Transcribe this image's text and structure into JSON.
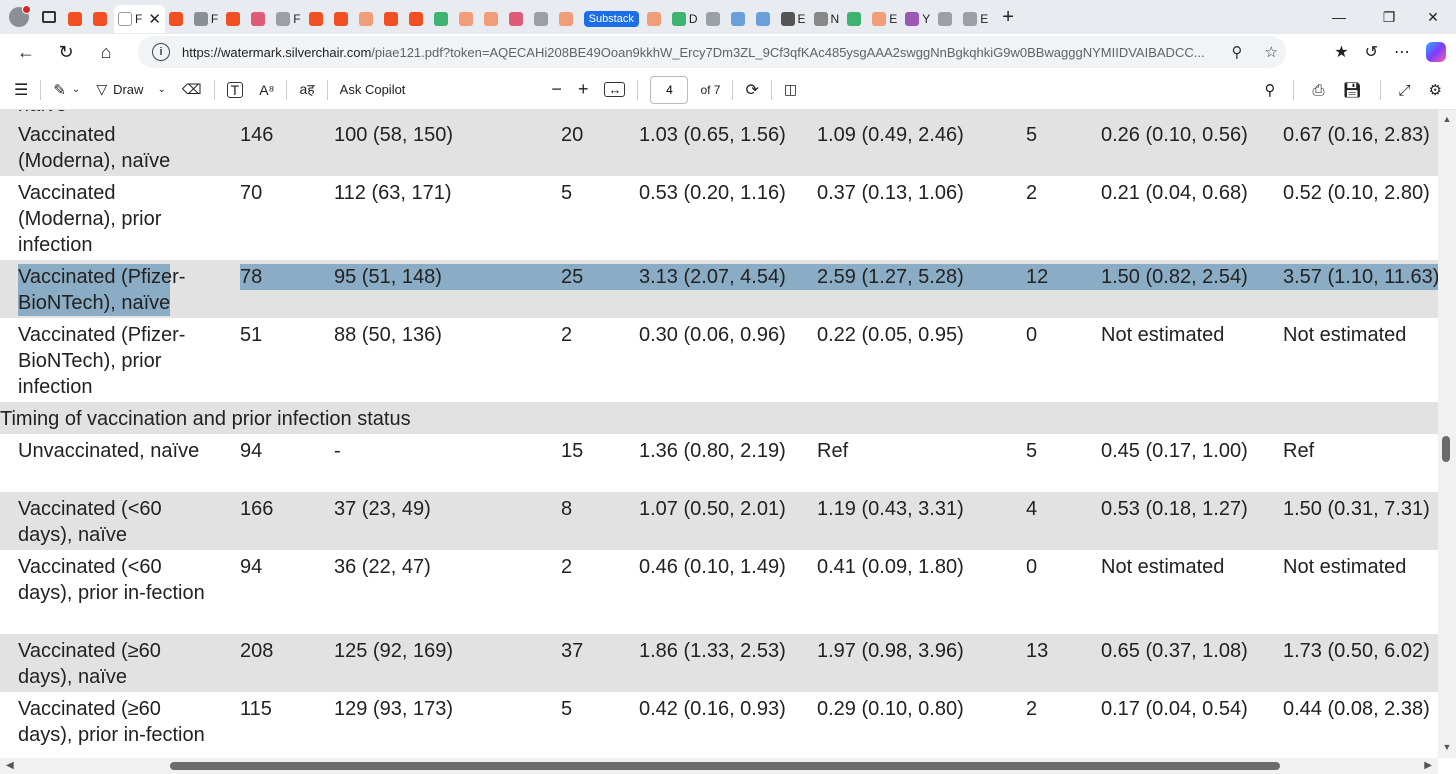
{
  "browser": {
    "tab_strip": [
      {
        "color": "#f25022",
        "letter": "",
        "active": false
      },
      {
        "color": "#f25022",
        "letter": "",
        "active": false
      },
      {
        "color": "#ffffff",
        "letter": "F",
        "active": true
      },
      {
        "color": "#f25022",
        "letter": "",
        "active": false
      },
      {
        "color": "#8a8f96",
        "letter": "F",
        "active": false
      },
      {
        "color": "#f25022",
        "letter": "",
        "active": false
      },
      {
        "color": "#e05a7a",
        "letter": "",
        "active": false
      },
      {
        "color": "#9aa0a6",
        "letter": "F",
        "active": false
      },
      {
        "color": "#f25022",
        "letter": "",
        "active": false
      },
      {
        "color": "#f25022",
        "letter": "",
        "active": false
      },
      {
        "color": "#f29d7a",
        "letter": "",
        "active": false
      },
      {
        "color": "#f25022",
        "letter": "",
        "active": false
      },
      {
        "color": "#f25022",
        "letter": "",
        "active": false
      },
      {
        "color": "#3cb371",
        "letter": "",
        "active": false
      },
      {
        "color": "#f29d7a",
        "letter": "",
        "active": false
      },
      {
        "color": "#f29d7a",
        "letter": "",
        "active": false
      },
      {
        "color": "#e05a7a",
        "letter": "",
        "active": false
      },
      {
        "color": "#9aa0a6",
        "letter": "",
        "active": false
      },
      {
        "color": "#f29d7a",
        "letter": "",
        "active": false
      }
    ],
    "active_tab_letter": "F",
    "substack_badge": "Substack",
    "tab_strip_right": [
      {
        "color": "#f29d7a",
        "letter": ""
      },
      {
        "color": "#3cb371",
        "letter": "D"
      },
      {
        "color": "#9aa0a6",
        "letter": ""
      },
      {
        "color": "#6aa0d8",
        "letter": ""
      },
      {
        "color": "#6aa0d8",
        "letter": ""
      },
      {
        "color": "#555555",
        "letter": "E"
      },
      {
        "color": "#888888",
        "letter": "N"
      },
      {
        "color": "#3cb371",
        "letter": ""
      },
      {
        "color": "#f29d7a",
        "letter": "E"
      },
      {
        "color": "#9b59b6",
        "letter": "Y"
      },
      {
        "color": "#9aa0a6",
        "letter": ""
      },
      {
        "color": "#9aa0a6",
        "letter": "E"
      }
    ],
    "url_host": "https://watermark.silverchair.com",
    "url_rest": "/piae121.pdf?token=AQECAHi208BE49Ooan9kkhW_Ercy7Dm3ZL_9Cf3qfKAc485ysgAAA2swggNnBgkqhkiG9w0BBwagggNYMIIDVAIBADCC..."
  },
  "pdf_toolbar": {
    "draw_label": "Draw",
    "ask_copilot": "Ask Copilot",
    "page_current": "4",
    "page_total": "of 7",
    "minus": "−",
    "plus": "+"
  },
  "table": {
    "partial_top_label": "naïve",
    "rows": [
      {
        "style": "gray",
        "label": "Vaccinated (Moderna), naïve",
        "c1": "146",
        "c2": "100 (58, 150)",
        "c3": "20",
        "c4": "1.03 (0.65, 1.56)",
        "c5": "1.09 (0.49, 2.46)",
        "c6": "5",
        "c7": "0.26 (0.10, 0.56)",
        "c8": "0.67 (0.16, 2.83)",
        "lines": 2
      },
      {
        "style": "white",
        "label": "Vaccinated (Moderna), prior infection",
        "c1": "70",
        "c2": "112 (63, 171)",
        "c3": "5",
        "c4": "0.53 (0.20, 1.16)",
        "c5": "0.37 (0.13, 1.06)",
        "c6": "2",
        "c7": "0.21 (0.04, 0.68)",
        "c8": "0.52 (0.10, 2.80)",
        "lines": 3
      },
      {
        "style": "hl",
        "label": "Vaccinated (Pfizer-BioNTech), naïve",
        "c1": "78",
        "c2": "95 (51, 148)",
        "c3": "25",
        "c4": "3.13 (2.07, 4.54)",
        "c5": "2.59 (1.27, 5.28)",
        "c6": "12",
        "c7": "1.50 (0.82, 2.54)",
        "c8": "3.57 (1.10, 11.63)",
        "lines": 2
      },
      {
        "style": "white",
        "label": "Vaccinated (Pfizer-BioNTech), prior infection",
        "c1": "51",
        "c2": "88 (50, 136)",
        "c3": "2",
        "c4": "0.30 (0.06, 0.96)",
        "c5": "0.22 (0.05, 0.95)",
        "c6": "0",
        "c7": "Not estimated",
        "c8": "Not estimated",
        "lines": 3
      },
      {
        "style": "section",
        "label": "Timing of vaccination and prior infection status"
      },
      {
        "style": "white",
        "label": "Unvaccinated, naïve",
        "c1": "94",
        "c2": "-",
        "c3": "15",
        "c4": "1.36 (0.80, 2.19)",
        "c5": "Ref",
        "c6": "5",
        "c7": "0.45 (0.17, 1.00)",
        "c8": "Ref",
        "lines": 2
      },
      {
        "style": "gray",
        "label": "Vaccinated (<60 days), naïve",
        "c1": "166",
        "c2": "37 (23, 49)",
        "c3": "8",
        "c4": "1.07 (0.50, 2.01)",
        "c5": "1.19 (0.43, 3.31)",
        "c6": "4",
        "c7": "0.53 (0.18, 1.27)",
        "c8": "1.50 (0.31, 7.31)",
        "lines": 2
      },
      {
        "style": "white",
        "label": "Vaccinated (<60 days), prior in-fection",
        "c1": "94",
        "c2": "36 (22, 47)",
        "c3": "2",
        "c4": "0.46 (0.10, 1.49)",
        "c5": "0.41 (0.09, 1.80)",
        "c6": "0",
        "c7": "Not estimated",
        "c8": "Not estimated",
        "lines": 3
      },
      {
        "style": "gray",
        "label": "Vaccinated (≥60 days), naïve",
        "c1": "208",
        "c2": "125 (92, 169)",
        "c3": "37",
        "c4": "1.86 (1.33, 2.53)",
        "c5": "1.97 (0.98, 3.96)",
        "c6": "13",
        "c7": "0.65 (0.37, 1.08)",
        "c8": "1.73 (0.50, 6.02)",
        "lines": 2
      },
      {
        "style": "white",
        "label": "Vaccinated (≥60 days), prior in-fection",
        "c1": "115",
        "c2": "129 (93, 173)",
        "c3": "5",
        "c4": "0.42 (0.16, 0.93)",
        "c5": "0.29 (0.10, 0.80)",
        "c6": "2",
        "c7": "0.17 (0.04, 0.54)",
        "c8": "0.44 (0.08, 2.38)",
        "lines": 3
      }
    ]
  }
}
